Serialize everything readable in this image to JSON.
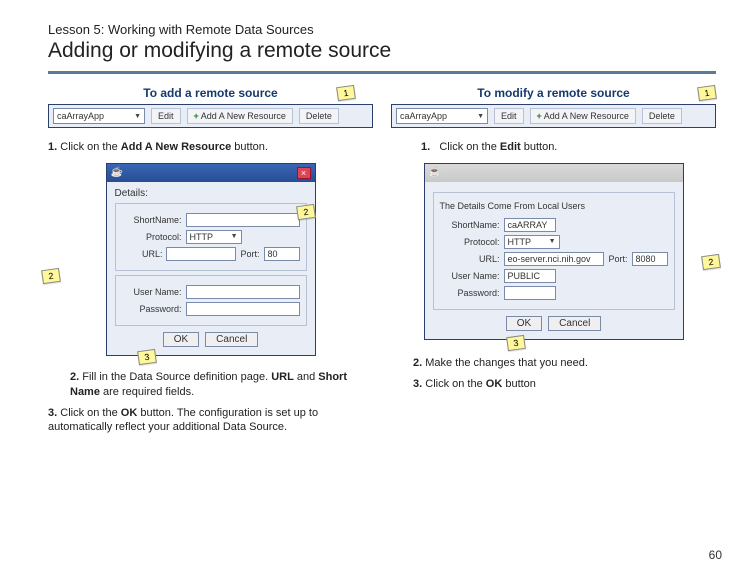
{
  "lesson_label": "Lesson 5: Working with Remote Data Sources",
  "title": "Adding or modifying a remote source",
  "page_number": "60",
  "left": {
    "heading": "To add a remote source",
    "callouts": {
      "c1": "1",
      "c2": "2",
      "c2b": "2",
      "c3": "3"
    },
    "toolbar": {
      "select_label": "caArrayApp",
      "btn_edit": "Edit",
      "btn_add": "Add A New Resource",
      "btn_delete": "Delete"
    },
    "step1_n": "1.",
    "step1_a": " Click on the ",
    "step1_b": "Add A New Resource",
    "step1_c": " button.",
    "dialog": {
      "title": "",
      "section": "Details:",
      "lbl_shortname": "ShortName:",
      "lbl_protocol": "Protocol:",
      "val_protocol": "HTTP",
      "lbl_url": "URL:",
      "lbl_port": "Port:",
      "val_port": "80",
      "lbl_user": "User Name:",
      "lbl_pass": "Password:",
      "btn_ok": "OK",
      "btn_cancel": "Cancel"
    },
    "step2_n": "2.",
    "step2_a": " Fill in the Data Source definition page. ",
    "step2_b": "URL",
    "step2_c": " and ",
    "step2_d": "Short Name",
    "step2_e": " are required fields.",
    "step3_n": "3.",
    "step3_a": " Click on the ",
    "step3_b": "OK",
    "step3_c": " button.  The configuration is set up to automatically reflect your additional Data Source."
  },
  "right": {
    "heading": "To modify a remote source",
    "callouts": {
      "c1": "1",
      "c2": "2",
      "c3": "3"
    },
    "toolbar": {
      "select_label": "caArrayApp",
      "btn_edit": "Edit",
      "btn_add": "Add A New Resource",
      "btn_delete": "Delete"
    },
    "step1_n": "1.",
    "step1_a": "Click on the ",
    "step1_b": "Edit",
    "step1_c": " button.",
    "dialog": {
      "grp_title": "The Details Come From Local Users",
      "lbl_shortname": "ShortName:",
      "val_shortname": "caARRAY",
      "lbl_protocol": "Protocol:",
      "val_protocol": "HTTP",
      "lbl_url": "URL:",
      "val_url": "eo-server.nci.nih.gov",
      "lbl_port": "Port:",
      "val_port": "8080",
      "lbl_user": "User Name:",
      "val_user": "PUBLIC",
      "lbl_pass": "Password:",
      "btn_ok": "OK",
      "btn_cancel": "Cancel"
    },
    "step2_n": "2.",
    "step2_a": " Make the changes that you need.",
    "step3_n": "3.",
    "step3_a": " Click on the ",
    "step3_b": "OK",
    "step3_c": " button"
  }
}
